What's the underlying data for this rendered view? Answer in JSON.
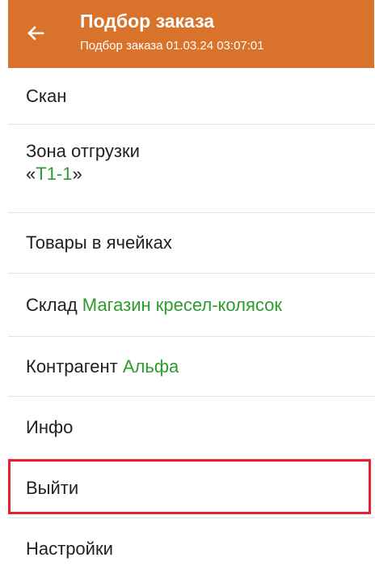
{
  "header": {
    "title": "Подбор заказа",
    "subtitle": "Подбор заказа 01.03.24 03:07:01",
    "back_icon": "arrow-left-icon",
    "color": "#d9732b"
  },
  "menu": {
    "scan": "Скан",
    "zone_label": "Зона отгрузки",
    "zone_open_quote": "«",
    "zone_value": "Т1-1",
    "zone_close_quote": "»",
    "goods_in_cells": "Товары в ячейках",
    "warehouse_label": "Склад",
    "warehouse_value": "Магазин кресел-колясок",
    "contractor_label": "Контрагент",
    "contractor_value": "Альфа",
    "info": "Инфо",
    "exit": "Выйти",
    "settings": "Настройки"
  },
  "colors": {
    "value_green": "#2e9b2e",
    "highlight_red": "#e8202f"
  }
}
